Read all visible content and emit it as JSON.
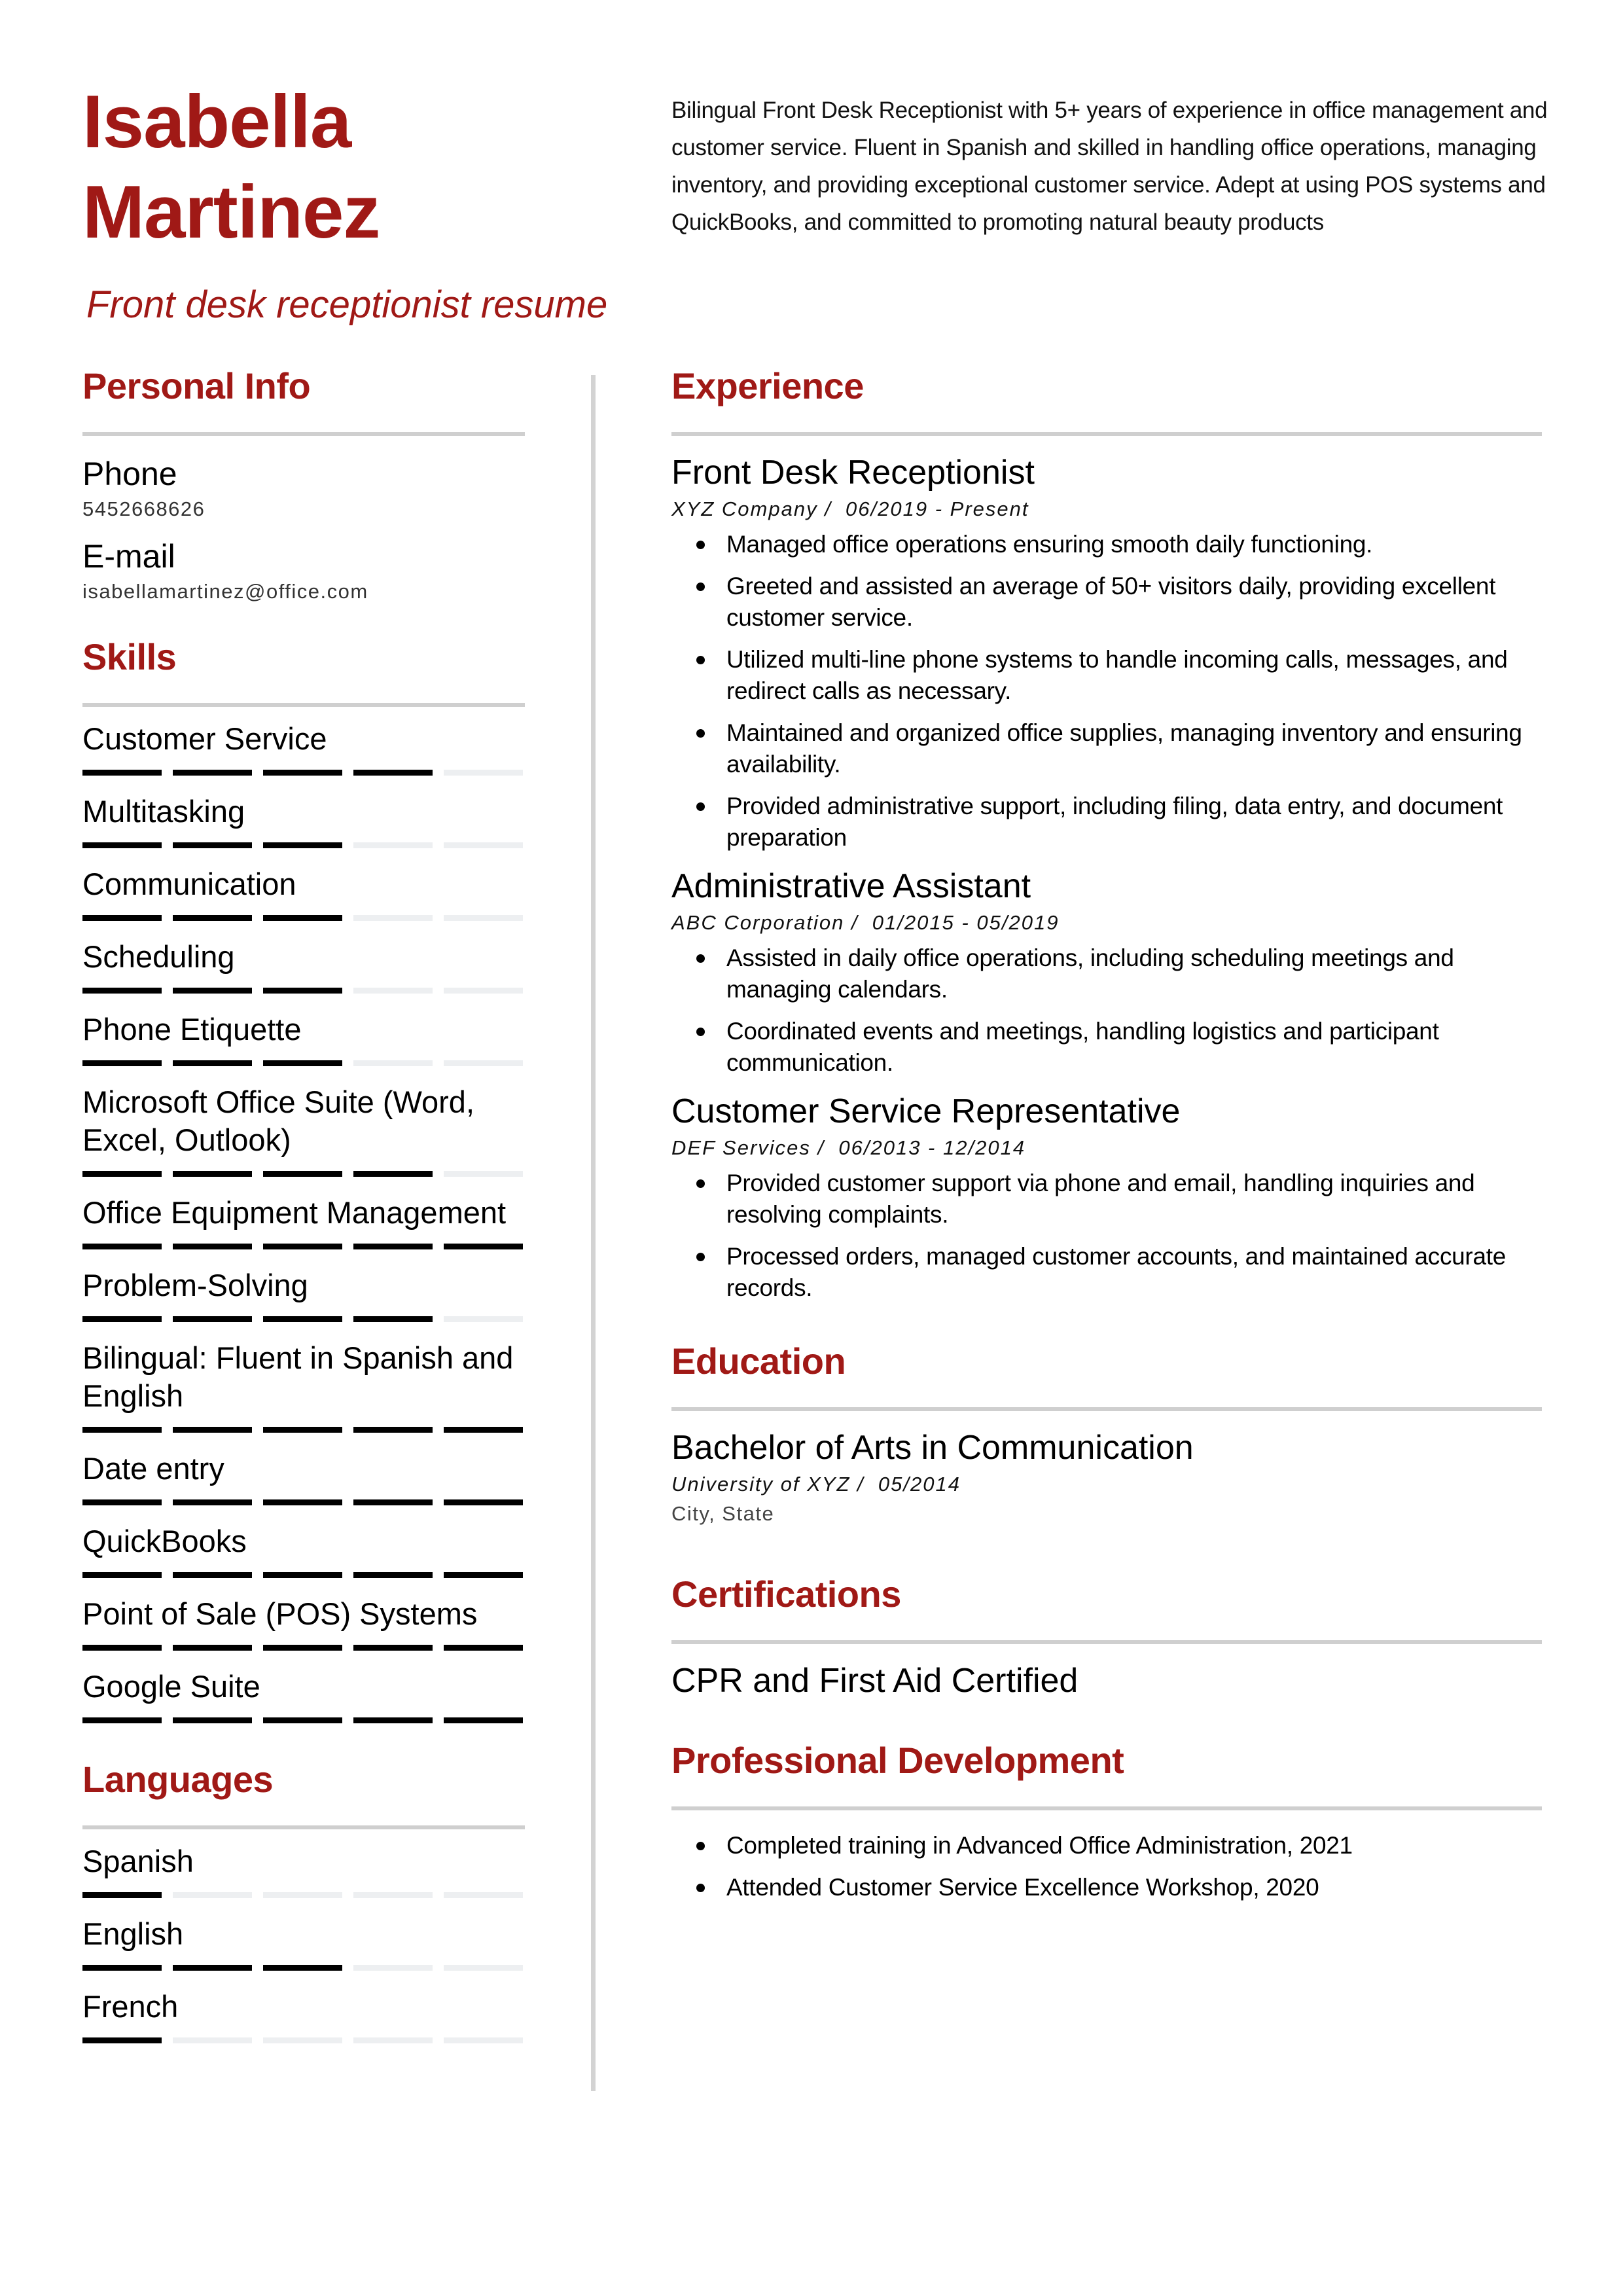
{
  "header": {
    "name_first": "Isabella",
    "name_last": "Martinez",
    "subtitle": "Front desk receptionist resume",
    "summary": "Bilingual Front Desk Receptionist with 5+ years of experience in office management and customer service. Fluent in Spanish and skilled in handling office operations, managing inventory, and providing exceptional customer service. Adept at using POS systems and QuickBooks, and committed to promoting natural beauty products"
  },
  "colors": {
    "accent": "#a01916",
    "rule": "#cfcfcf",
    "bar_filled": "#000000",
    "bar_empty": "#edeff1"
  },
  "personal_info": {
    "heading": "Personal Info",
    "phone_label": "Phone",
    "phone_value": "5452668626",
    "email_label": "E-mail",
    "email_value": "isabellamartinez@office.com"
  },
  "skills": {
    "heading": "Skills",
    "scale_max": 5,
    "items": [
      {
        "label": "Customer Service",
        "level": 4
      },
      {
        "label": "Multitasking",
        "level": 3
      },
      {
        "label": "Communication",
        "level": 3
      },
      {
        "label": "Scheduling",
        "level": 3
      },
      {
        "label": "Phone Etiquette",
        "level": 3
      },
      {
        "label": "Microsoft Office Suite (Word, Excel, Outlook)",
        "level": 4
      },
      {
        "label": "Office Equipment Management",
        "level": 5
      },
      {
        "label": "Problem-Solving",
        "level": 4
      },
      {
        "label": "Bilingual: Fluent in Spanish and English",
        "level": 5
      },
      {
        "label": "Date entry",
        "level": 5
      },
      {
        "label": "QuickBooks",
        "level": 5
      },
      {
        "label": "Point of Sale (POS) Systems",
        "level": 5
      },
      {
        "label": "Google Suite",
        "level": 5
      }
    ]
  },
  "languages": {
    "heading": "Languages",
    "scale_max": 5,
    "items": [
      {
        "label": "Spanish",
        "level": 1
      },
      {
        "label": "English",
        "level": 3
      },
      {
        "label": "French",
        "level": 1
      }
    ]
  },
  "experience": {
    "heading": "Experience",
    "jobs": [
      {
        "title": "Front Desk Receptionist",
        "company": "XYZ Company /",
        "dates": "06/2019 - Present",
        "bullets": [
          "Managed office operations ensuring smooth daily functioning.",
          "Greeted and assisted an average of 50+ visitors daily, providing excellent customer service.",
          "Utilized multi-line phone systems to handle incoming calls, messages, and redirect calls as necessary.",
          "Maintained and organized office supplies, managing inventory and ensuring availability.",
          "Provided administrative support, including filing, data entry, and document preparation"
        ]
      },
      {
        "title": "Administrative Assistant",
        "company": "ABC Corporation /",
        "dates": "01/2015 - 05/2019",
        "bullets": [
          "Assisted in daily office operations, including scheduling meetings and managing calendars.",
          "Coordinated events and meetings, handling logistics and participant communication."
        ]
      },
      {
        "title": "Customer Service Representative",
        "company": "DEF Services /",
        "dates": "06/2013 - 12/2014",
        "bullets": [
          "Provided customer support via phone and email, handling inquiries and resolving complaints.",
          "Processed orders, managed customer accounts, and maintained accurate records."
        ]
      }
    ]
  },
  "education": {
    "heading": "Education",
    "degree": "Bachelor of Arts in Communication",
    "school": "University of XYZ /",
    "date": "05/2014",
    "location": "City, State"
  },
  "certifications": {
    "heading": "Certifications",
    "items": [
      "CPR and First Aid Certified"
    ]
  },
  "professional_development": {
    "heading": "Professional Development",
    "items": [
      "Completed training in Advanced Office Administration, 2021",
      "Attended Customer Service Excellence Workshop, 2020"
    ]
  }
}
